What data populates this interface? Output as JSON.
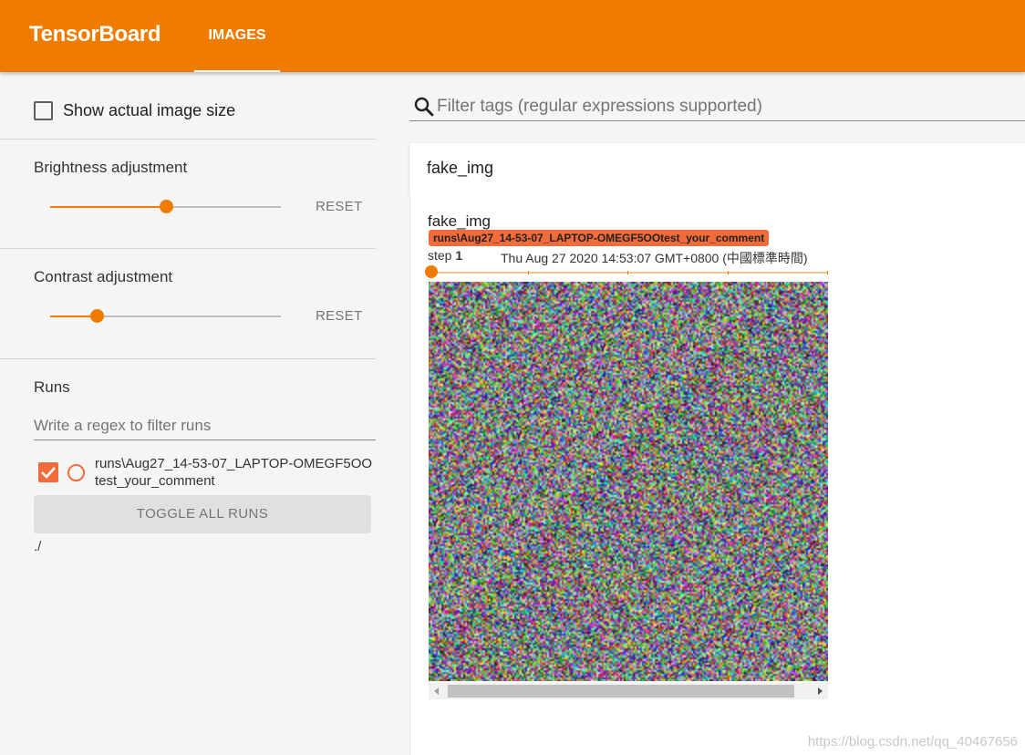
{
  "header": {
    "brand": "TensorBoard",
    "tabs": [
      {
        "label": "IMAGES",
        "active": true
      }
    ],
    "color": "#ef7c00"
  },
  "sidebar": {
    "show_actual_size": {
      "label": "Show actual image size",
      "checked": false
    },
    "brightness": {
      "label": "Brightness adjustment",
      "value": 0.5,
      "reset_label": "RESET"
    },
    "contrast": {
      "label": "Contrast adjustment",
      "value": 0.2,
      "reset_label": "RESET"
    },
    "runs": {
      "title": "Runs",
      "filter_placeholder": "Write a regex to filter runs",
      "items": [
        {
          "name": "runs\\Aug27_14-53-07_LAPTOP-OMEGF5OOtest_your_comment",
          "checked": true,
          "color": "#f26b3a"
        }
      ],
      "toggle_label": "TOGGLE ALL RUNS",
      "logdir": "./"
    }
  },
  "main": {
    "search": {
      "placeholder": "Filter tags (regular expressions supported)",
      "icon": "search-icon"
    },
    "category": {
      "title": "fake_img"
    },
    "card": {
      "title": "fake_img",
      "run_chip": "runs\\Aug27_14-53-07_LAPTOP-OMEGF5OOtest_your_comment",
      "step_label": "step",
      "step_value": "1",
      "timestamp": "Thu Aug 27 2020 14:53:07 GMT+0800 (中國標準時間)"
    }
  },
  "watermark": "https://blog.csdn.net/qq_40467656"
}
